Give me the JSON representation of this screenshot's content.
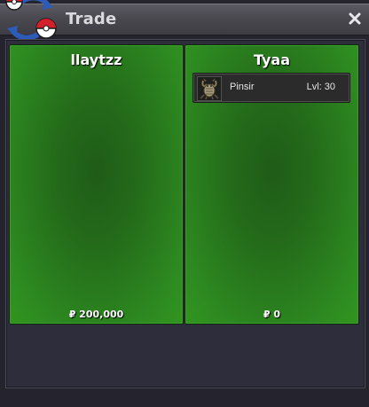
{
  "window": {
    "title": "Trade",
    "logo_icon": "pokeball-swap-icon",
    "close_icon": "close-icon"
  },
  "trade": {
    "left": {
      "name": "llaytzz",
      "money": "₽ 200,000",
      "items": []
    },
    "right": {
      "name": "Tyaa",
      "money": "₽ 0",
      "items": [
        {
          "icon": "pinsir-icon",
          "name": "Pinsir",
          "level": "Lvl: 30"
        }
      ]
    }
  },
  "colors": {
    "panel_green": "#2d8a20",
    "panel_green_dark": "#1f5c18",
    "titlebar": "#4a4950",
    "background": "#24232e"
  }
}
